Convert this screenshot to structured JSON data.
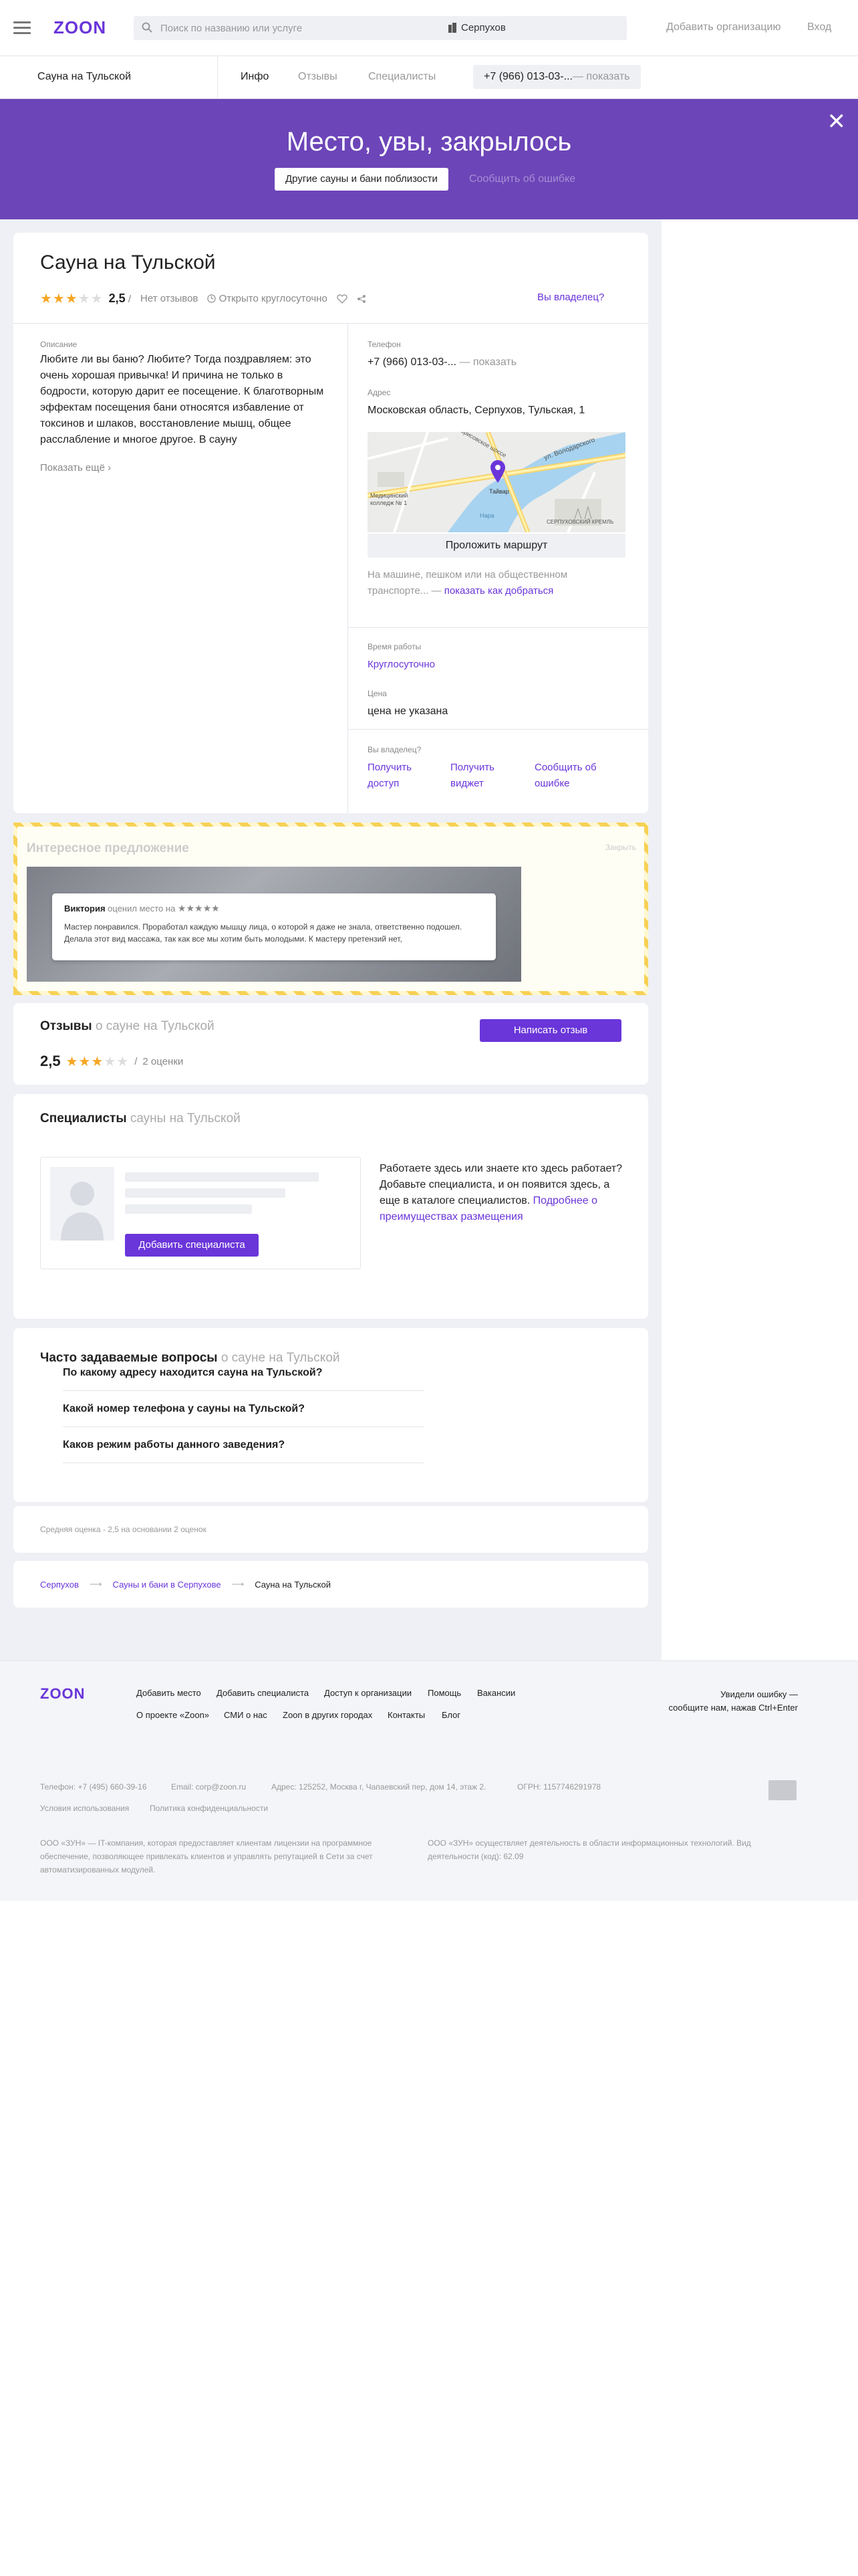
{
  "header": {
    "logo": "ZOON",
    "search_placeholder": "Поиск по названию или услуге",
    "city": "Серпухов",
    "add_org": "Добавить организацию",
    "login": "Вход"
  },
  "subnav": {
    "place_name": "Сауна на Тульской",
    "tabs": [
      "Инфо",
      "Отзывы",
      "Специалисты"
    ],
    "phone": "+7 (966) 013-03-...",
    "show": "— показать"
  },
  "banner": {
    "title": "Место, увы, закрылось",
    "other_btn": "Другие сауны и бани поблизости",
    "report": "Сообщить об ошибке"
  },
  "place": {
    "title": "Сауна на Тульской",
    "rating": "2,5",
    "no_reviews": "Нет отзывов",
    "open": "Открыто круглосуточно",
    "owner": "Вы владелец?"
  },
  "description": {
    "label": "Описание",
    "text": "Любите ли вы баню? Любите? Тогда поздравляем: это очень хорошая привычка! И причина не только в бодрости, которую дарит ее посещение. К благотворным эффектам посещения бани относятся избавление от токсинов и шлаков, восстановление мышц, общее расслабление и многое другое. В сауну",
    "more": "Показать ещё ›"
  },
  "contacts": {
    "phone_label": "Телефон",
    "phone": "+7 (966) 013-03-...",
    "phone_show": "— показать",
    "address_label": "Адрес",
    "address": "Московская область, Серпухов, Тульская, 1",
    "route_btn": "Проложить маршрут",
    "transport": "На машине, пешком или на общественном транспорте... —",
    "transport_link": "показать как добраться",
    "map_labels": [
      "Борисовское шоссе",
      "ул. Володарского",
      "Тайвар",
      "Медицинский колледж № 1",
      "СЕРПУХОВСКИЙ КРЕМЛЬ",
      "Нара"
    ]
  },
  "hours": {
    "label": "Время работы",
    "value": "Круглосуточно",
    "price_label": "Цена",
    "price": "цена не указана"
  },
  "owner_block": {
    "label": "Вы владелец?",
    "links": [
      "Получить доступ",
      "Получить виджет",
      "Сообщить об ошибке"
    ]
  },
  "offer": {
    "title": "Интересное предложение",
    "close": "Закрыть",
    "reviewer": "Виктория",
    "action": "оценил место на",
    "stars": "★★★★★",
    "text": "Мастер понравился. Проработал каждую мышцу лица, о которой я даже не знала, ответственно подошел. Делала этот вид массажа, так как все мы хотим быть молодыми. К мастеру претензий нет,"
  },
  "reviews": {
    "title": "Отзывы",
    "subtitle": "о сауне на Тульской",
    "btn": "Написать отзыв",
    "rating": "2,5",
    "count": "2 оценки"
  },
  "specialists": {
    "title": "Специалисты",
    "subtitle": "сауны на Тульской",
    "add_btn": "Добавить специалиста",
    "text": "Работаете здесь или знаете кто здесь работает? Добавьте специалиста, и он появится здесь, а еще в каталоге специалистов.",
    "link": "Подробнее о преимуществах размещения"
  },
  "faq": {
    "title": "Часто задаваемые вопросы",
    "subtitle": "о сауне на Тульской",
    "items": [
      "По какому адресу находится сауна на Тульской?",
      "Какой номер телефона у сауны на Тульской?",
      "Каков режим работы данного заведения?"
    ]
  },
  "avg": "Средняя оценка - 2,5 на основании 2 оценок",
  "breadcrumbs": [
    "Серпухов",
    "Сауны и бани в Серпухове",
    "Сауна на Тульской"
  ],
  "footer": {
    "logo": "ZOON",
    "links1": [
      "Добавить место",
      "Добавить специалиста",
      "Доступ к организации",
      "Помощь",
      "Вакансии"
    ],
    "links2": [
      "О проекте «Zoon»",
      "СМИ о нас",
      "Zoon в других городах",
      "Контакты",
      "Блог"
    ],
    "error_line1": "Увидели ошибку —",
    "error_line2": "сообщите нам, нажав Ctrl+Enter",
    "phone": "Телефон: +7 (495) 660-39-16",
    "email": "Email: corp@zoon.ru",
    "address": "Адрес: 125252, Москва г, Чапаевский пер, дом 14, этаж 2.",
    "ogrn": "ОГРН: 1157746291978",
    "terms": "Условия использования",
    "privacy": "Политика конфиденциальности",
    "legal1": "ООО «ЗУН» — IT-компания, которая предоставляет клиентам лицензии на программное обеспечение, позволяющее привлекать клиентов и управлять репутацией в Сети за счет автоматизированных модулей.",
    "legal2": "ООО «ЗУН» осуществляет деятельность в области информационных технологий. Вид деятельности (код): 62.09"
  },
  "colors": {
    "accent": "#6a35d9",
    "banner": "#6c45b8",
    "star": "#f5a623"
  }
}
